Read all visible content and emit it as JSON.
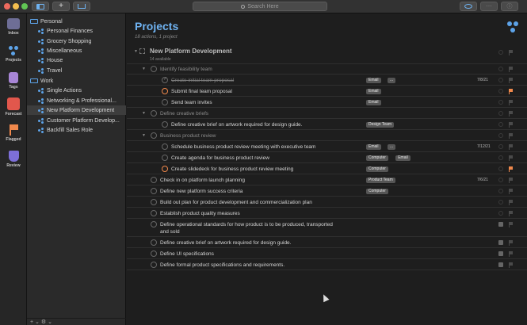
{
  "toolbar": {
    "search_placeholder": "Search Here"
  },
  "perspectives": [
    {
      "label": "Inbox",
      "color": "#8f8fb8"
    },
    {
      "label": "Projects",
      "color": "#5da3e8"
    },
    {
      "label": "Tags",
      "color": "#a886d6"
    },
    {
      "label": "Forecast",
      "color": "#e2574c"
    },
    {
      "label": "Flagged",
      "color": "#f0894c"
    },
    {
      "label": "Review",
      "color": "#7d6fd8"
    }
  ],
  "sidebar": {
    "folders": [
      {
        "label": "Personal",
        "projects": [
          "Personal Finances",
          "Grocery Shopping",
          "Miscellaneous",
          "House",
          "Travel"
        ]
      },
      {
        "label": "Work",
        "projects": [
          "Single Actions",
          "Networking & Professional...",
          "New Platform Development",
          "Customer Platform Develop...",
          "Backfill Sales Role"
        ]
      }
    ],
    "selected": "New Platform Development",
    "bottom": "+ ⌄  ⚙ ⌄"
  },
  "main": {
    "title": "Projects",
    "subtitle": "18 actions, 1 project",
    "project": {
      "title": "New Platform Development",
      "subtitle": "14 available"
    },
    "rows": [
      {
        "kind": "group",
        "text": "Identify feasibility team",
        "indent": 1
      },
      {
        "kind": "done",
        "text": "Create initial team proposal",
        "indent": 2,
        "tags": [
          "Email",
          "..."
        ],
        "date": "7/8/21"
      },
      {
        "kind": "task",
        "text": "Submit final team proposal",
        "indent": 2,
        "tags": [
          "Email"
        ],
        "flag": true,
        "orange": true
      },
      {
        "kind": "task",
        "text": "Send team invites",
        "indent": 2,
        "tags": [
          "Email"
        ]
      },
      {
        "kind": "group",
        "text": "Define creative briefs",
        "indent": 1
      },
      {
        "kind": "task",
        "text": "Define creative brief on artwork required for design guide.",
        "indent": 2,
        "tags": [
          "Design Team"
        ]
      },
      {
        "kind": "group",
        "text": "Business product review",
        "indent": 1
      },
      {
        "kind": "task",
        "text": "Schedule business product review meeting with executive team",
        "indent": 2,
        "tags": [
          "Email",
          "..."
        ],
        "date": "7/12/21"
      },
      {
        "kind": "task",
        "text": "Create agenda for business product review",
        "indent": 2,
        "tags": [
          "Computer",
          "Email"
        ]
      },
      {
        "kind": "task",
        "text": "Create slidedeck for business product review meeting",
        "indent": 2,
        "tags": [
          "Computer"
        ],
        "flag": true,
        "orange": true
      },
      {
        "kind": "task",
        "text": "Check in on platform launch planning",
        "indent": 1,
        "tags": [
          "Product Team"
        ],
        "date": "7/6/21"
      },
      {
        "kind": "task",
        "text": "Define new platform success criteria",
        "indent": 1,
        "tags": [
          "Computer"
        ]
      },
      {
        "kind": "task",
        "text": "Build out plan for product development and commercialization plan",
        "indent": 1
      },
      {
        "kind": "task",
        "text": "Establish product quality measures",
        "indent": 1
      },
      {
        "kind": "task2",
        "text": "Define operational standards for how product is to be produced, transported",
        "text2": "and sold",
        "indent": 1,
        "noteicon": true
      },
      {
        "kind": "task",
        "text": "Define creative brief on artwork required for design guide.",
        "indent": 1,
        "noteicon": true
      },
      {
        "kind": "task",
        "text": "Define UI specifications",
        "indent": 1,
        "noteicon": true
      },
      {
        "kind": "task",
        "text": "Define formal product specifications and requirements.",
        "indent": 1,
        "noteicon": true
      }
    ]
  }
}
